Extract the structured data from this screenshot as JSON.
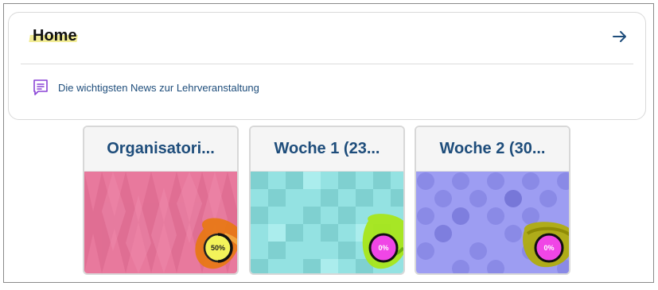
{
  "home": {
    "title": "Home",
    "arrow_icon": "arrow-right-icon",
    "news": {
      "icon": "news-icon",
      "label": "Die wichtigsten News zur Lehrveranstaltung"
    }
  },
  "courses": [
    {
      "title": "Organisatori...",
      "progress": 0.5,
      "progress_label": "50%",
      "color": "#e8799d",
      "annotation_color": "#e8780f"
    },
    {
      "title": "Woche 1 (23...",
      "progress": 0,
      "progress_label": "0%",
      "color": "#94e2e2",
      "annotation_color": "#a8e61a"
    },
    {
      "title": "Woche 2 (30...",
      "progress": 0,
      "progress_label": "0%",
      "color": "#9d9df2",
      "annotation_color": "#b0ad0d"
    }
  ],
  "colors": {
    "accent": "#1e4d7b",
    "highlight": "#f2ec94",
    "progress_fill": "#f046e6"
  }
}
